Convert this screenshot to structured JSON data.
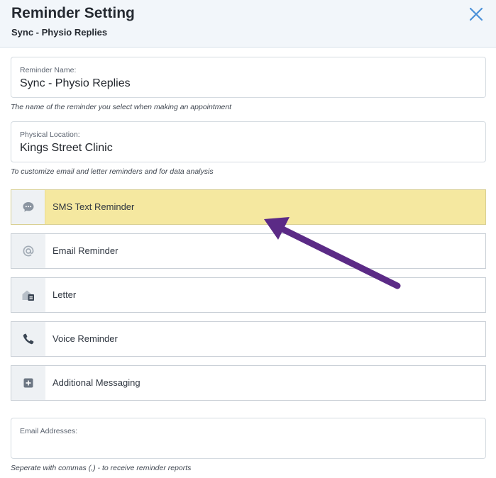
{
  "header": {
    "title": "Reminder Setting",
    "subtitle": "Sync - Physio Replies"
  },
  "reminder_name": {
    "label": "Reminder Name:",
    "value": "Sync - Physio Replies",
    "hint": "The name of the reminder you select when making an appointment"
  },
  "physical_location": {
    "label": "Physical Location:",
    "value": "Kings Street Clinic",
    "hint": "To customize email and letter reminders and for data analysis"
  },
  "reminder_types": [
    {
      "label": "SMS Text Reminder",
      "icon": "chat-bubble-icon",
      "highlighted": true
    },
    {
      "label": "Email Reminder",
      "icon": "at-sign-icon",
      "highlighted": false
    },
    {
      "label": "Letter",
      "icon": "letter-icon",
      "highlighted": false
    },
    {
      "label": "Voice Reminder",
      "icon": "phone-icon",
      "highlighted": false
    },
    {
      "label": "Additional Messaging",
      "icon": "plus-square-icon",
      "highlighted": false
    }
  ],
  "email_addresses": {
    "label": "Email Addresses:",
    "value": "",
    "hint": "Seperate with commas (,) - to receive reminder reports"
  },
  "colors": {
    "highlight": "#f5e8a0",
    "arrow": "#5b2a86",
    "close": "#4a90d9"
  }
}
